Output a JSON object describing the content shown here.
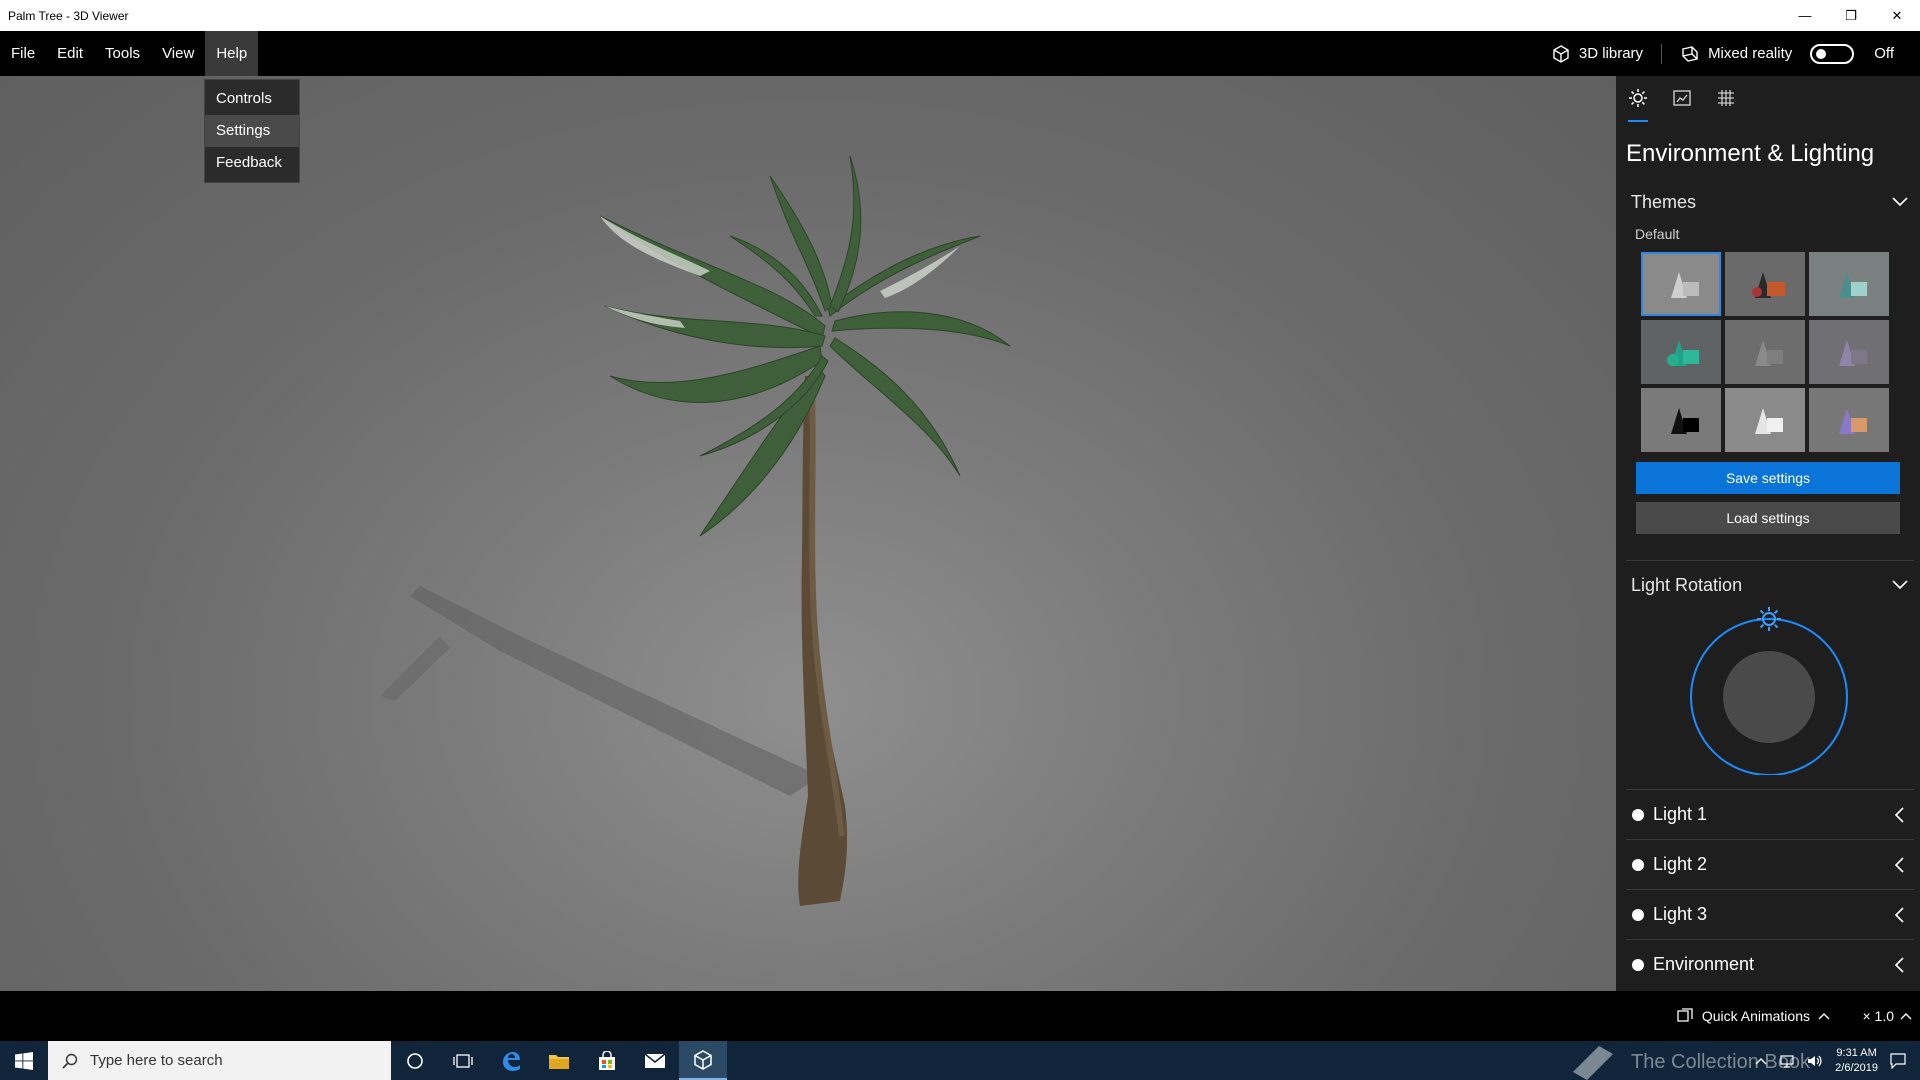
{
  "window": {
    "title": "Palm Tree - 3D Viewer",
    "minimize": "—",
    "maximize": "❐",
    "close": "✕"
  },
  "menubar": {
    "items": [
      "File",
      "Edit",
      "Tools",
      "View",
      "Help"
    ],
    "library_label": "3D library",
    "mixed_reality_label": "Mixed reality",
    "mixed_reality_state": "Off"
  },
  "help_menu": {
    "items": [
      "Controls",
      "Settings",
      "Feedback"
    ]
  },
  "panel": {
    "heading": "Environment & Lighting",
    "themes_label": "Themes",
    "default_label": "Default",
    "save_label": "Save settings",
    "load_label": "Load settings",
    "light_rotation_label": "Light Rotation",
    "lights": [
      "Light 1",
      "Light 2",
      "Light 3",
      "Environment"
    ]
  },
  "statusbar": {
    "quick_animations": "Quick Animations",
    "speed": "× 1.0"
  },
  "taskbar": {
    "search_placeholder": "Type here to search",
    "time": "9:31 AM",
    "date": "2/6/2019",
    "watermark": "The Collection Book"
  },
  "colors": {
    "accent": "#0a74d9",
    "dial_ring": "#1a8cff",
    "panel_bg": "#1e1e1e"
  }
}
